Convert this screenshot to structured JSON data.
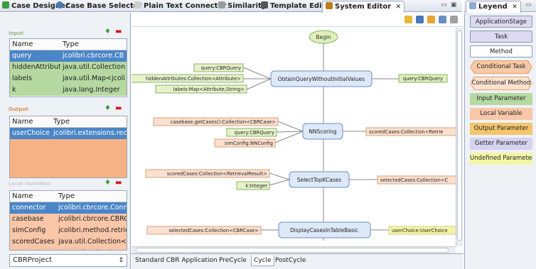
{
  "tabs": [
    {
      "label": "Case Designer",
      "color": "#3c9b3a"
    },
    {
      "label": "Case Base Selector",
      "color": "#4a78b8"
    },
    {
      "label": "Plain Text Connector",
      "color": "#8a8a8a"
    },
    {
      "label": "Similarity",
      "color": "#6a6a6a"
    },
    {
      "label": "Template Editor",
      "color": "#444444"
    },
    {
      "label": "System Editor",
      "color": "#c07a1a"
    }
  ],
  "legend_tab": {
    "label": "Leyend"
  },
  "left": {
    "input": {
      "title": "Input",
      "columns": [
        "Name",
        "Type"
      ],
      "rows": [
        {
          "name": "query",
          "type": "jcolibri.cbrcore.CB"
        },
        {
          "name": "hiddenAttributes",
          "type": "java.util.Collection"
        },
        {
          "name": "labels",
          "type": "java.util.Map<jcoli"
        },
        {
          "name": "k",
          "type": "java.lang.Integer"
        }
      ]
    },
    "output": {
      "title": "Output",
      "columns": [
        "Name",
        "Type"
      ],
      "rows": [
        {
          "name": "userChoice",
          "type": "jcolibri.extensions.recor"
        }
      ]
    },
    "local": {
      "title": "Local Variables",
      "columns": [
        "Name",
        "Type"
      ],
      "rows": [
        {
          "name": "connector",
          "type": "jcolibri.cbrcore.Conne"
        },
        {
          "name": "casebase",
          "type": "jcolibri.cbrcore.CBRC"
        },
        {
          "name": "simConfig",
          "type": "jcolibri.method.retriev"
        },
        {
          "name": "scoredCases",
          "type": "java.util.Collection<jc"
        },
        {
          "name": "selectedCases",
          "type": "java.util.Collection<jc"
        }
      ]
    },
    "project": {
      "value": "CBRProject"
    }
  },
  "diagram": {
    "begin": "Begin",
    "steps": [
      {
        "name": "ObtainQueryWithoutInitialValues",
        "params_left": [
          "query:CBRQuery",
          "hiddenAttributes:Collection<Attribute>",
          "labels:Map<Attribute,String>"
        ],
        "output": "query:CBRQuery"
      },
      {
        "name": "NNScoring",
        "params_left": [
          "casebase.getCases():Collection<CBRCase>",
          "query:CBRQuery",
          "simConfig:NNConfig"
        ],
        "output": "scoredCases:Collection<Retrie"
      },
      {
        "name": "SelectTopKCases",
        "params_left": [
          "scoredCases:Collection<RetrievalResult>",
          "k:Integer"
        ],
        "output": "selectedCases:Collection<C"
      },
      {
        "name": "DisplayCasesInTableBasic",
        "params_left": [
          "selectedCases:Collection<CBRCase>"
        ],
        "output": "userChoice:UserChoice"
      }
    ]
  },
  "bottom_tabs": [
    "Standard CBR Application",
    "PreCycle",
    "Cycle",
    "PostCycle"
  ],
  "active_bottom_tab": "Cycle",
  "legend": [
    {
      "label": "ApplicationStage",
      "shape": "box",
      "color": "#dcd9f0"
    },
    {
      "label": "Task",
      "shape": "box",
      "color": "#dcd9f0"
    },
    {
      "label": "Method",
      "shape": "box",
      "color": "#ffffff"
    },
    {
      "label": "Conditional Task",
      "shape": "hex",
      "color": "#f7c9a6"
    },
    {
      "label": "Conditional Method",
      "shape": "hex",
      "color": "#fde2d0"
    },
    {
      "label": "Input Parameter",
      "shape": "flat",
      "color": "#b6d9a1"
    },
    {
      "label": "Local Variable",
      "shape": "flat",
      "color": "#f9c6a8"
    },
    {
      "label": "Output Parameter",
      "shape": "flat",
      "color": "#f3c56c"
    },
    {
      "label": "Getter Parameter",
      "shape": "flat",
      "color": "#d6d3f0"
    },
    {
      "label": "Undefined Parameter",
      "shape": "flat",
      "color": "#f3f5a6"
    }
  ],
  "colors": {
    "selection": "#4a86c7",
    "input_row": "#b6d9a1",
    "output_panel": "#f6b184",
    "local_row": "#f9c6a8",
    "method_box": "#dde9f8",
    "input_param": "#e6f2c8",
    "output_param": "#dff0b9",
    "local_param": "#fbe0cf"
  }
}
